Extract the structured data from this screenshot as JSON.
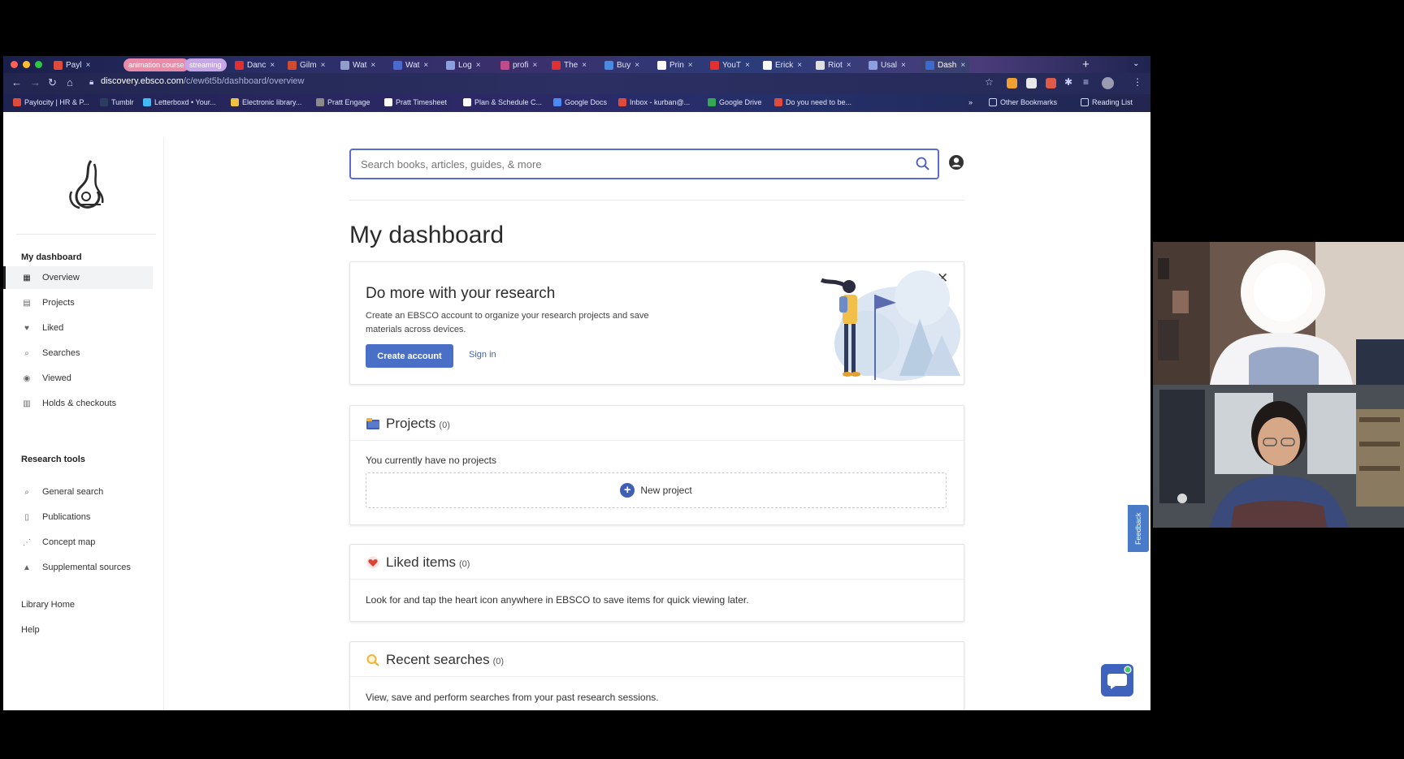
{
  "browser": {
    "tabs": [
      {
        "label": "Payl",
        "color": "#e04a3a"
      },
      {
        "label": "animation course",
        "color": "#e88aa8",
        "pill": true
      },
      {
        "label": "streaming",
        "color": "#c7a6e8",
        "pill": true
      },
      {
        "label": "Danc",
        "color": "#e03030"
      },
      {
        "label": "Gilm",
        "color": "#d04a30"
      },
      {
        "label": "Wat",
        "color": "#8ea0c8"
      },
      {
        "label": "Wat",
        "color": "#4a6ad0"
      },
      {
        "label": "Log",
        "color": "#8aa0e0"
      },
      {
        "label": "profi",
        "color": "#c04a8a"
      },
      {
        "label": "The",
        "color": "#e03030"
      },
      {
        "label": "Buy",
        "color": "#4a8ae0"
      },
      {
        "label": "Prin",
        "color": "#ffffff"
      },
      {
        "label": "YouT",
        "color": "#e03030"
      },
      {
        "label": "Erick",
        "color": "#ffffff"
      },
      {
        "label": "Riot",
        "color": "#e0e0e0"
      },
      {
        "label": "Usal",
        "color": "#8aa0e0"
      },
      {
        "label": "Dash",
        "color": "#3b6bd0",
        "active": true
      }
    ],
    "url_host": "discovery.ebsco.com",
    "url_path": "/c/ew6t5b/dashboard/overview",
    "bookmarks": [
      {
        "label": "Paylocity | HR & P...",
        "color": "#e04a3a"
      },
      {
        "label": "Tumblr",
        "color": "#2c3e60"
      },
      {
        "label": "Letterboxd • Your...",
        "color": "#40bcf4"
      },
      {
        "label": "Electronic library...",
        "color": "#f0c040"
      },
      {
        "label": "Pratt Engage",
        "color": "#8a8a8a"
      },
      {
        "label": "Pratt Timesheet",
        "color": "#ffffff"
      },
      {
        "label": "Plan & Schedule C...",
        "color": "#ffffff"
      },
      {
        "label": "Google Docs",
        "color": "#4a8af4"
      },
      {
        "label": "Inbox - kurban@...",
        "color": "#e04a3a"
      },
      {
        "label": "Google Drive",
        "color": "#34a853"
      },
      {
        "label": "Do you need to be...",
        "color": "#e04a3a"
      }
    ],
    "bookmark_overflow": "»",
    "other_bookmarks": "Other Bookmarks",
    "reading_list": "Reading List"
  },
  "sidebar": {
    "heading_dashboard": "My dashboard",
    "items": [
      {
        "label": "Overview",
        "icon": "overview-icon",
        "active": true
      },
      {
        "label": "Projects",
        "icon": "projects-icon"
      },
      {
        "label": "Liked",
        "icon": "heart-icon"
      },
      {
        "label": "Searches",
        "icon": "search-icon"
      },
      {
        "label": "Viewed",
        "icon": "eye-icon"
      },
      {
        "label": "Holds & checkouts",
        "icon": "books-icon"
      }
    ],
    "heading_tools": "Research tools",
    "tools": [
      {
        "label": "General search",
        "icon": "search-icon"
      },
      {
        "label": "Publications",
        "icon": "document-icon"
      },
      {
        "label": "Concept map",
        "icon": "concept-map-icon"
      },
      {
        "label": "Supplemental sources",
        "icon": "institution-icon"
      }
    ],
    "library_home": "Library Home",
    "help": "Help"
  },
  "search": {
    "placeholder": "Search books, articles, guides, & more"
  },
  "dashboard": {
    "title": "My dashboard",
    "promo": {
      "title": "Do more with your research",
      "text": "Create an EBSCO account to organize your research projects and save materials across devices.",
      "create_label": "Create account",
      "signin_label": "Sign in"
    },
    "projects": {
      "title": "Projects",
      "count": "(0)",
      "empty_text": "You currently have no projects",
      "new_label": "New project"
    },
    "liked": {
      "title": "Liked items",
      "count": "(0)",
      "text": "Look for and tap the heart icon anywhere in EBSCO to save items for quick viewing later."
    },
    "recent": {
      "title": "Recent searches",
      "count": "(0)",
      "text": "View, save and perform searches from your past research sessions."
    }
  },
  "feedback_label": "Feedback",
  "colors": {
    "accent": "#4a6fc7",
    "link": "#3d63c0",
    "search_border": "#5b6cd0"
  }
}
